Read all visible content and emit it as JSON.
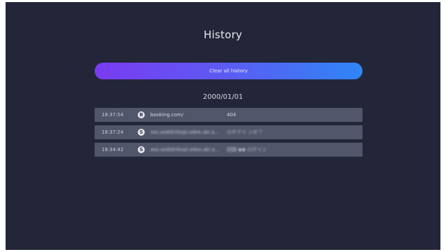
{
  "title": "History",
  "clear_button": "Clear all history",
  "date": "2000/01/01",
  "entries": [
    {
      "time": "18:37:54",
      "icon_letter": "B",
      "url": "booking.com/",
      "page_title": "404"
    },
    {
      "time": "18:37:24",
      "icon_letter": "S",
      "url": "ses.sedidnikopi.odoe.aki.a...",
      "page_title": "ロチテリ ンゼ ？"
    },
    {
      "time": "18:34:42",
      "icon_letter": "S",
      "url": "aso.sedidnikopi.odoe.aki.a...",
      "page_title": "回国 ◆◆ ログイン"
    }
  ]
}
